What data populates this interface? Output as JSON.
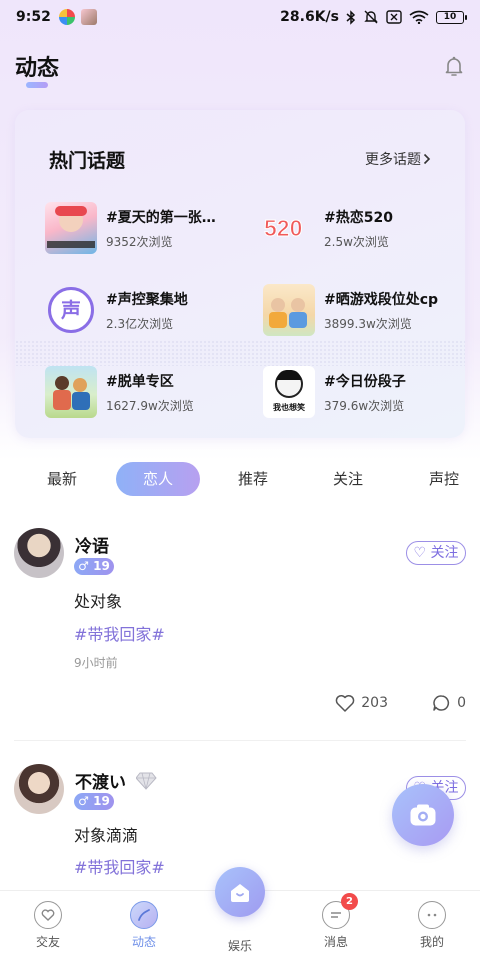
{
  "status_bar": {
    "time": "9:52",
    "network_speed": "28.6K/s",
    "battery": "10"
  },
  "header": {
    "title": "动态"
  },
  "hot_topics": {
    "title": "热门话题",
    "more_label": "更多话题",
    "items": [
      {
        "name": "#夏天的第一张…",
        "views": "9352次浏览",
        "icon": "summer-photo-thumb"
      },
      {
        "name": "#热恋520",
        "views": "2.5w次浏览",
        "icon": "520-thumb"
      },
      {
        "name": "#声控聚集地",
        "views": "2.3亿次浏览",
        "icon": "voice-thumb",
        "thumb_text": "声"
      },
      {
        "name": "#晒游戏段位处cp",
        "views": "3899.3w次浏览",
        "icon": "game-thumb"
      },
      {
        "name": "#脱单专区",
        "views": "1627.9w次浏览",
        "icon": "couple-thumb"
      },
      {
        "name": "#今日份段子",
        "views": "379.6w次浏览",
        "icon": "meme-thumb",
        "thumb_text": "我也想笑"
      }
    ]
  },
  "tabs": {
    "items": [
      "最新",
      "恋人",
      "推荐",
      "关注",
      "声控"
    ],
    "active": "恋人"
  },
  "posts": [
    {
      "username": "冷语",
      "gender": "♂",
      "age": "19",
      "follow_label": "关注",
      "text": "处对象",
      "tag": "#带我回家#",
      "time": "9小时前",
      "likes": "203",
      "comments": "0"
    },
    {
      "username": "不渡い",
      "gender": "♂",
      "age": "19",
      "follow_label": "关注",
      "text": "对象滴滴",
      "tag": "#带我回家#"
    }
  ],
  "bottom_nav": {
    "items": [
      {
        "label": "交友",
        "icon": "friends-icon"
      },
      {
        "label": "动态",
        "icon": "moments-icon"
      },
      {
        "label": "娱乐",
        "icon": "home-icon"
      },
      {
        "label": "消息",
        "icon": "message-icon",
        "badge": "2"
      },
      {
        "label": "我的",
        "icon": "profile-icon"
      }
    ],
    "active": "动态"
  },
  "colors": {
    "accent_start": "#8fb1f7",
    "accent_end": "#b7a0f0",
    "tag": "#8272d9",
    "badge": "#f24b4b"
  }
}
